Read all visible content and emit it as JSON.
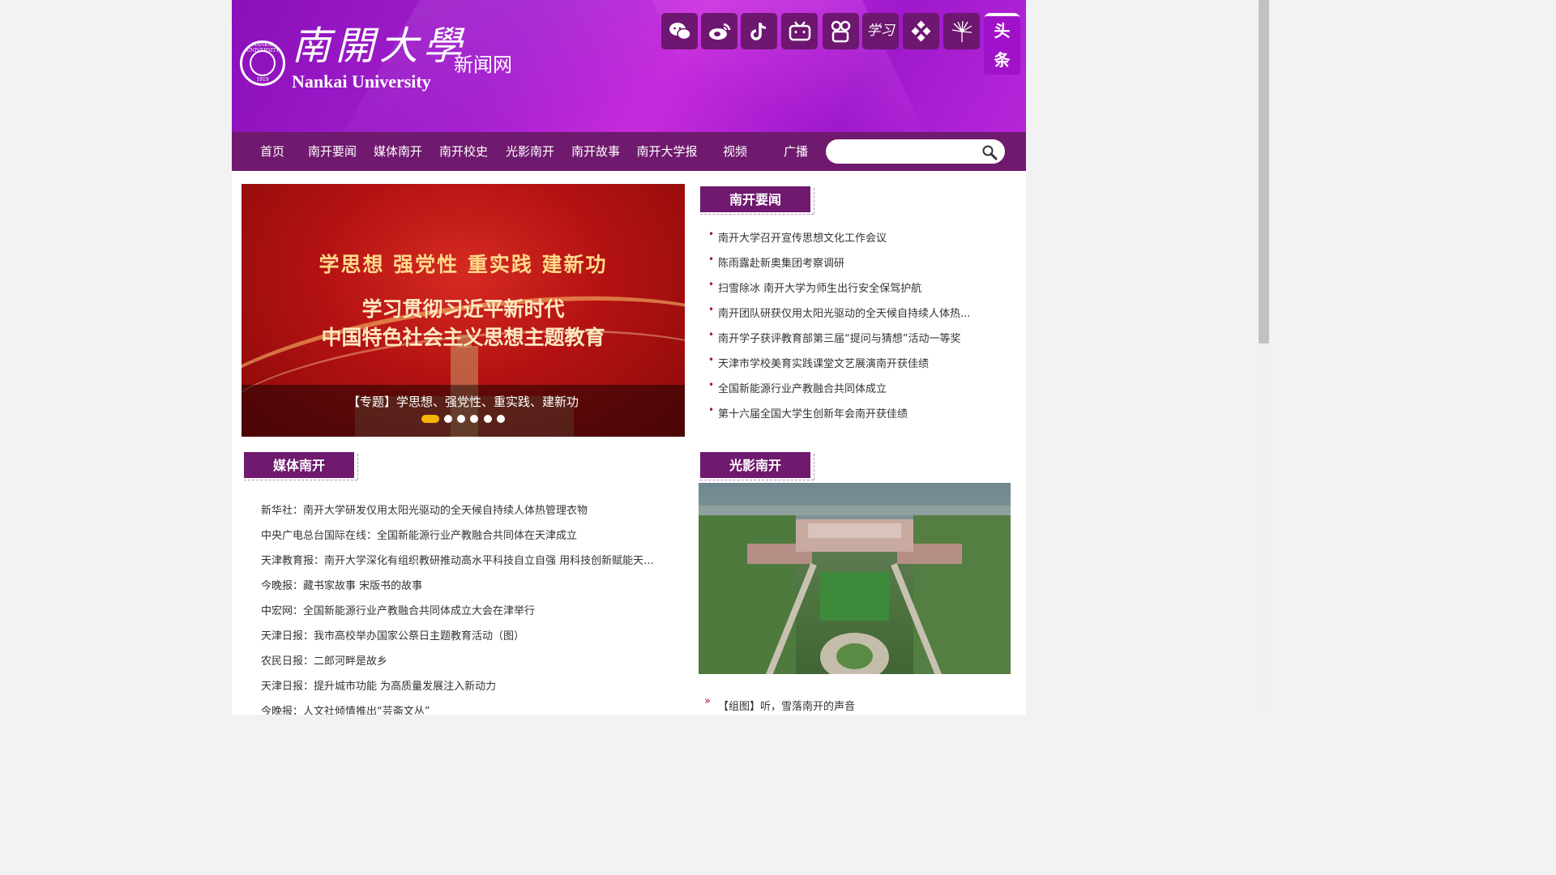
{
  "header": {
    "logo_cn": "南開大學",
    "logo_en": "Nankai University",
    "site_name": "新闻网",
    "seal_text": "NANKAI UNIVERSITY",
    "seal_year": "1919",
    "seal_center": "南開",
    "social": [
      "wechat-icon",
      "weibo-icon",
      "douyin-icon",
      "bilibili-icon",
      "kuaishou-icon",
      "xuexi-icon",
      "channels-icon",
      "dandelion-icon",
      "toutiao-icon"
    ],
    "toutiao_label": "头条",
    "xuexi_label": "学习"
  },
  "nav": {
    "items": [
      "首页",
      "南开要闻",
      "媒体南开",
      "南开校史",
      "光影南开",
      "南开故事",
      "南开大学报",
      "视频",
      "广播"
    ],
    "search_placeholder": ""
  },
  "slider": {
    "headline1": "学思想  强党性  重实践  建新功",
    "headline2": "学习贯彻习近平新时代",
    "headline3": "中国特色社会主义思想主题教育",
    "caption": "【专题】学思想、强党性、重实践、建新功",
    "dot_count": 6,
    "active_dot": 1
  },
  "nankai_news": {
    "title": "南开要闻",
    "items": [
      "南开大学召开宣传思想文化工作会议",
      "陈雨露赴新奥集团考察调研",
      "扫雪除冰 南开大学为师生出行安全保驾护航",
      "南开团队研获仅用太阳光驱动的全天候自持续人体热...",
      "南开学子获评教育部第三届“提问与猜想”活动一等奖",
      "天津市学校美育实践课堂文艺展演南开获佳绩",
      "全国新能源行业产教融合共同体成立",
      "第十六届全国大学生创新年会南开获佳绩"
    ]
  },
  "media_nankai": {
    "title": "媒体南开",
    "items": [
      "新华社：南开大学研发仅用太阳光驱动的全天候自持续人体热管理衣物",
      "中央广电总台国际在线：全国新能源行业产教融合共同体在天津成立",
      "天津教育报：南开大学深化有组织教研推动高水平科技自立自强 用科技创新赋能天...",
      "今晚报：藏书家故事 宋版书的故事",
      "中宏网：全国新能源行业产教融合共同体成立大会在津举行",
      "天津日报：我市高校举办国家公祭日主题教育活动（图）",
      "农民日报：二郎河畔是故乡",
      "天津日报：提升城市功能 为高质量发展注入新动力",
      "今晚报：人文社倾情推出“芸斋文丛”"
    ]
  },
  "photo_nankai": {
    "title": "光影南开",
    "caption": "【组图】听，雪落南开的声音"
  },
  "colors": {
    "nav_bg": "#6f1a6e",
    "header_purple": "#a41fd0",
    "bullet": "#a0173a",
    "active_dot": "#f4b400"
  }
}
